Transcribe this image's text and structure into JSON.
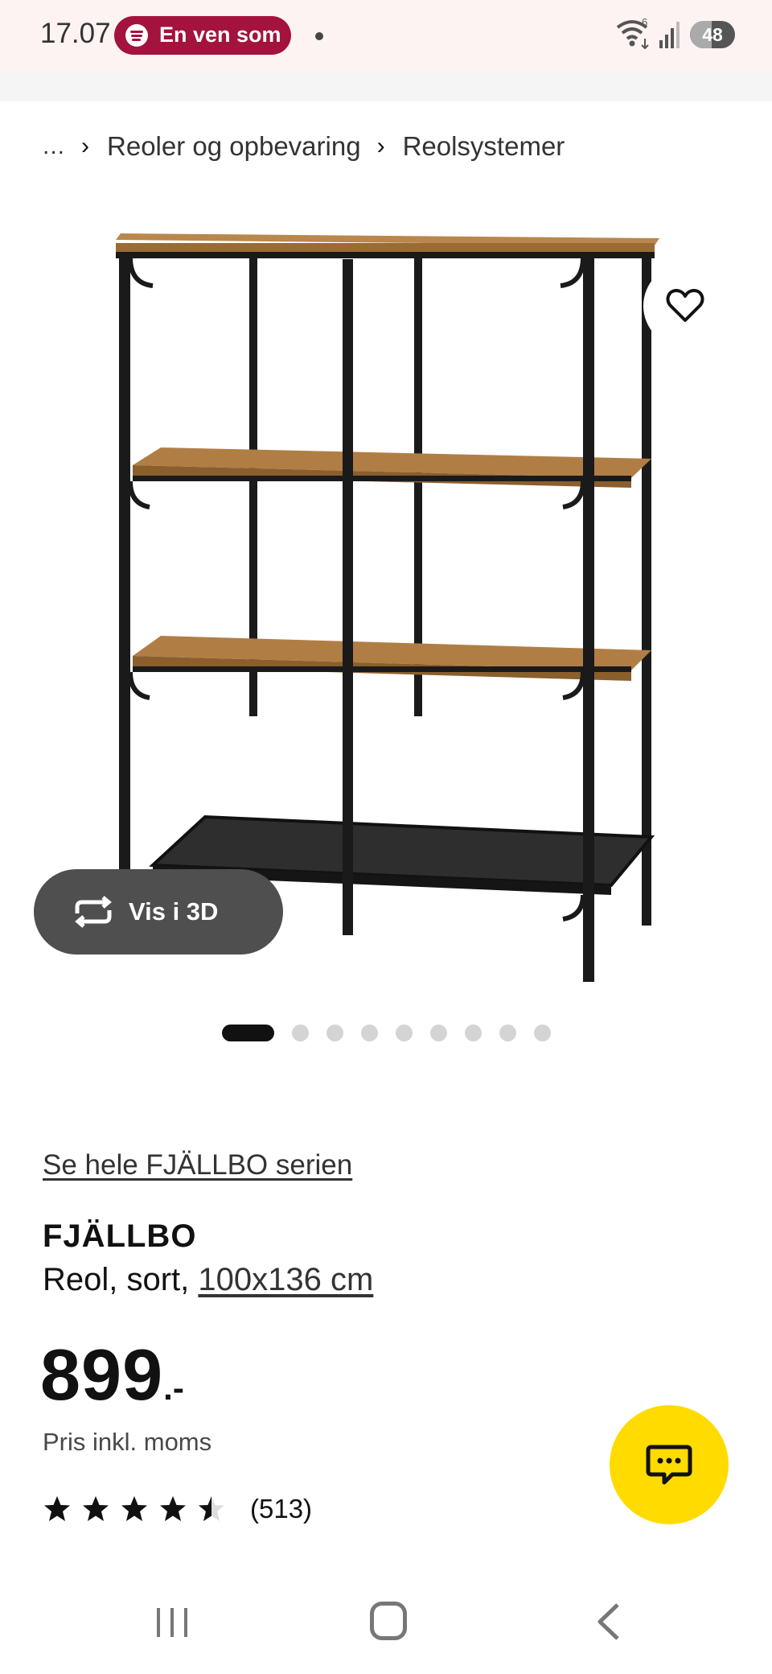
{
  "status_bar": {
    "time": "17.07",
    "spotify_text": "En ven som",
    "network_badge": "6",
    "battery": "48",
    "battery_level_percent": 48
  },
  "breadcrumb": {
    "ellipsis": "...",
    "items": [
      "Reoler og opbevaring",
      "Reolsystemer"
    ]
  },
  "gallery": {
    "view_3d_label": "Vis i 3D",
    "dot_count": 9,
    "active_index": 0
  },
  "product": {
    "series_link": "Se hele FJÄLLBO serien",
    "name": "FJÄLLBO",
    "description_prefix": "Reol, sort, ",
    "dimensions": "100x136 cm",
    "price_integer": "899",
    "price_suffix": ".-",
    "price_note": "Pris inkl. moms",
    "rating_value": 4.5,
    "rating_max": 5,
    "review_count": "(513)"
  },
  "colors": {
    "brand_yellow": "#ffdb00",
    "spotify_pill": "#a3133d",
    "vis3d_bg": "#4f4f4f",
    "shelf_wood": "#a1723a",
    "frame": "#1a1a1a"
  },
  "icons": {
    "favorite": "heart-icon",
    "view_3d": "rotate-3d-icon",
    "chat": "chat-icon",
    "star": "star-icon"
  }
}
